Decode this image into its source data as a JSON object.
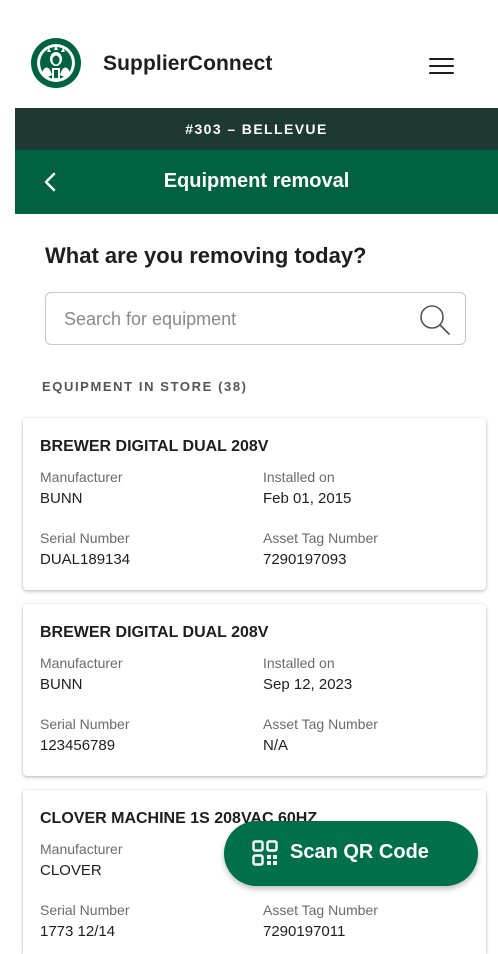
{
  "header": {
    "app_title": "SupplierConnect",
    "logo_icon": "siren-logo-icon",
    "menu_icon": "hamburger-menu-icon"
  },
  "store_bar": {
    "label": "#303 – BELLEVUE"
  },
  "nav": {
    "title": "Equipment removal",
    "back_icon": "chevron-left-icon"
  },
  "main": {
    "question": "What are you removing today?",
    "search": {
      "placeholder": "Search for equipment",
      "value": "",
      "icon": "search-icon"
    },
    "section_label": "EQUIPMENT IN STORE (38)"
  },
  "equipment": [
    {
      "name": "BREWER DIGITAL DUAL 208V",
      "manufacturer_label": "Manufacturer",
      "manufacturer": "BUNN",
      "installed_label": "Installed on",
      "installed": "Feb 01, 2015",
      "serial_label": "Serial Number",
      "serial": "DUAL189134",
      "asset_label": "Asset Tag Number",
      "asset": "7290197093"
    },
    {
      "name": "BREWER DIGITAL DUAL 208V",
      "manufacturer_label": "Manufacturer",
      "manufacturer": "BUNN",
      "installed_label": "Installed on",
      "installed": "Sep 12, 2023",
      "serial_label": "Serial Number",
      "serial": "123456789",
      "asset_label": "Asset Tag Number",
      "asset": "N/A"
    },
    {
      "name": "CLOVER MACHINE 1S 208VAC 60HZ",
      "manufacturer_label": "Manufacturer",
      "manufacturer": "CLOVER",
      "serial_label": "Serial Number",
      "serial": "1773 12/14",
      "asset_label": "Asset Tag Number",
      "asset": "7290197011"
    }
  ],
  "fab": {
    "label": "Scan QR Code",
    "icon": "qr-code-icon"
  },
  "colors": {
    "brand_green": "#006241",
    "house_green": "#1e3932",
    "accent_green": "#00704a"
  }
}
